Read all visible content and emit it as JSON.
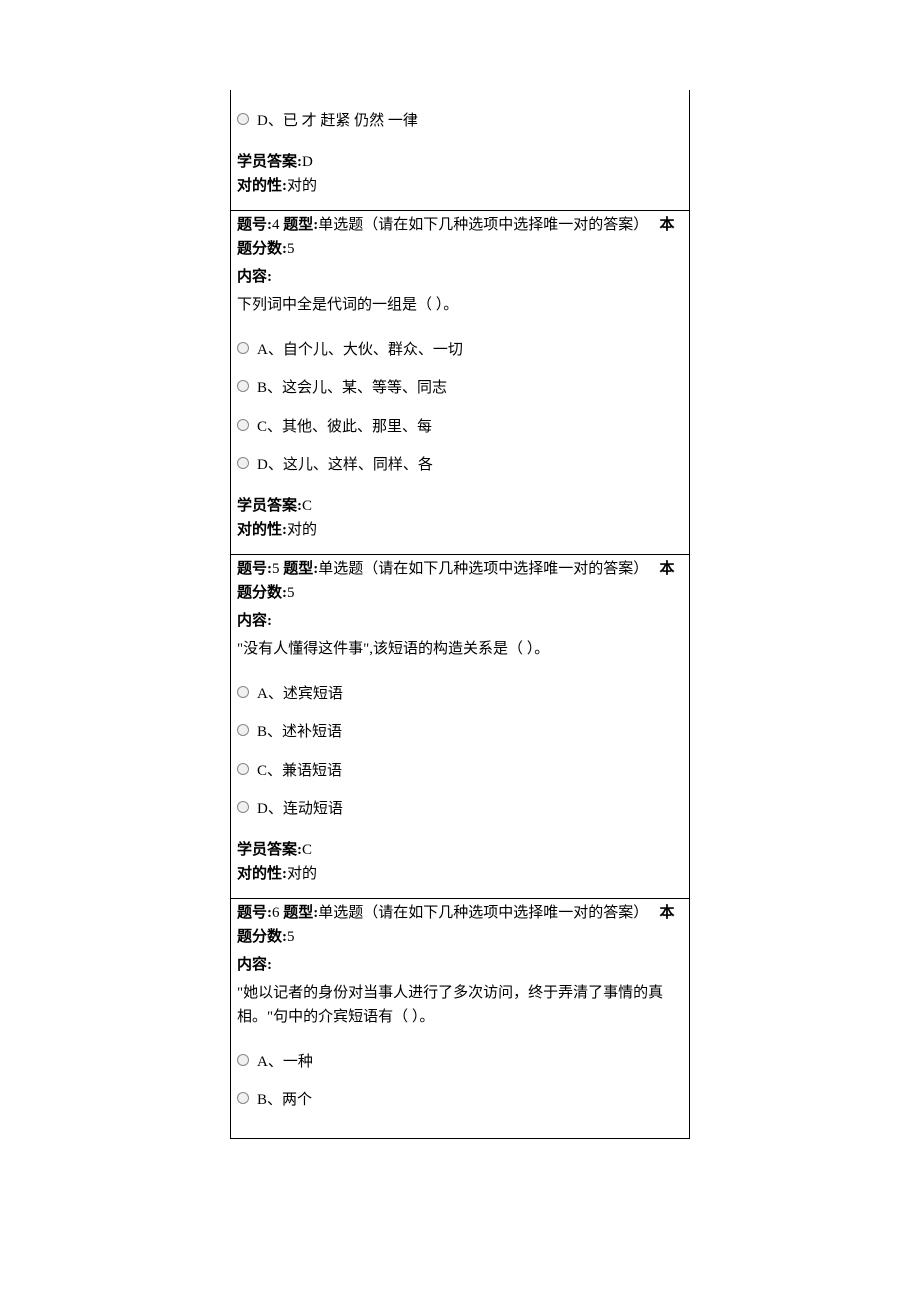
{
  "q3": {
    "optionD": "D、已  才  赶紧  仍然  一律",
    "answerLabel": "学员答案:",
    "answerValue": "D",
    "correctLabel": "对的性:",
    "correctValue": "对的"
  },
  "q4": {
    "headerPrefix": "题号:",
    "number": "4",
    "typeLabel": "题型:",
    "typeValue": "单选题（请在如下几种选项中选择唯一对的答案）",
    "scorePrefix": "本题分数:",
    "scoreValue": "5",
    "contentLabel": "内容:",
    "contentText": "下列词中全是代词的一组是（ ）。",
    "optionA": "A、自个儿、大伙、群众、一切",
    "optionB": "B、这会儿、某、等等、同志",
    "optionC": "C、其他、彼此、那里、每",
    "optionD": "D、这儿、这样、同样、各",
    "answerLabel": "学员答案:",
    "answerValue": "C",
    "correctLabel": "对的性:",
    "correctValue": "对的"
  },
  "q5": {
    "headerPrefix": "题号:",
    "number": "5",
    "typeLabel": "题型:",
    "typeValue": "单选题（请在如下几种选项中选择唯一对的答案）",
    "scorePrefix": "本题分数:",
    "scoreValue": "5",
    "contentLabel": "内容:",
    "contentText": "\"没有人懂得这件事\",该短语的构造关系是（ ）。",
    "optionA": "A、述宾短语",
    "optionB": "B、述补短语",
    "optionC": "C、兼语短语",
    "optionD": "D、连动短语",
    "answerLabel": "学员答案:",
    "answerValue": "C",
    "correctLabel": "对的性:",
    "correctValue": "对的"
  },
  "q6": {
    "headerPrefix": "题号:",
    "number": "6",
    "typeLabel": "题型:",
    "typeValue": "单选题（请在如下几种选项中选择唯一对的答案）",
    "scorePrefix": "本题分数:",
    "scoreValue": "5",
    "contentLabel": "内容:",
    "contentText": "\"她以记者的身份对当事人进行了多次访问，终于弄清了事情的真相。\"句中的介宾短语有（ ）。",
    "optionA": "A、一种",
    "optionB": "B、两个"
  }
}
